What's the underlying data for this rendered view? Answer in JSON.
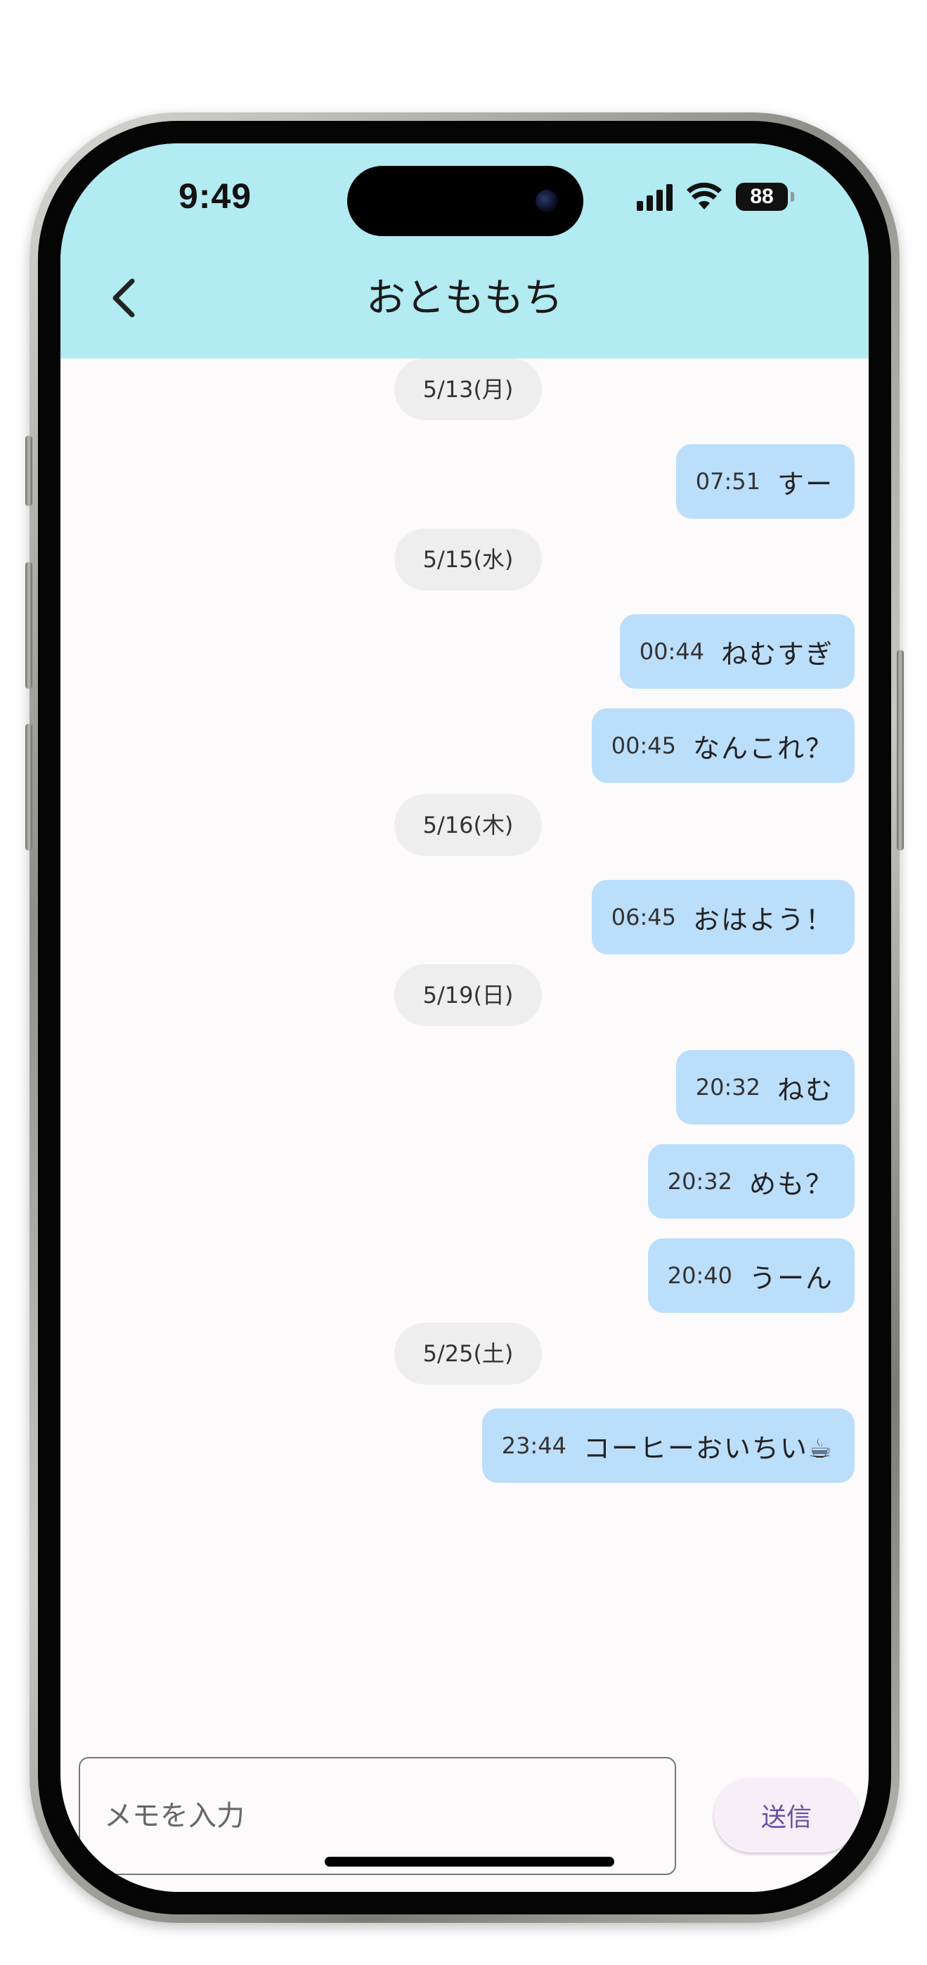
{
  "status_bar": {
    "time": "9:49",
    "battery": "88"
  },
  "header": {
    "title": "おとももち",
    "back_icon": "chevron-left-icon",
    "background": "#b2ebf2"
  },
  "messages": [
    {
      "type": "date",
      "label": "5/13(月)"
    },
    {
      "type": "memo",
      "time": "07:51",
      "text": "すー"
    },
    {
      "type": "date",
      "label": "5/15(水)"
    },
    {
      "type": "memo",
      "time": "00:44",
      "text": "ねむすぎ"
    },
    {
      "type": "memo",
      "time": "00:45",
      "text": "なんこれ？"
    },
    {
      "type": "date",
      "label": "5/16(木)"
    },
    {
      "type": "memo",
      "time": "06:45",
      "text": "おはよう！"
    },
    {
      "type": "date",
      "label": "5/19(日)"
    },
    {
      "type": "memo",
      "time": "20:32",
      "text": "ねむ"
    },
    {
      "type": "memo",
      "time": "20:32",
      "text": "めも？"
    },
    {
      "type": "memo",
      "time": "20:40",
      "text": "うーん"
    },
    {
      "type": "date",
      "label": "5/25(土)"
    },
    {
      "type": "memo",
      "time": "23:44",
      "text": "コーヒーおいちい☕"
    }
  ],
  "composer": {
    "placeholder": "メモを入力",
    "value": "",
    "send_label": "送信"
  },
  "colors": {
    "bubble": "#bbdefb",
    "date_chip": "#eeeeee",
    "accent": "#6750a4",
    "screen_background": "#fdfafc"
  }
}
